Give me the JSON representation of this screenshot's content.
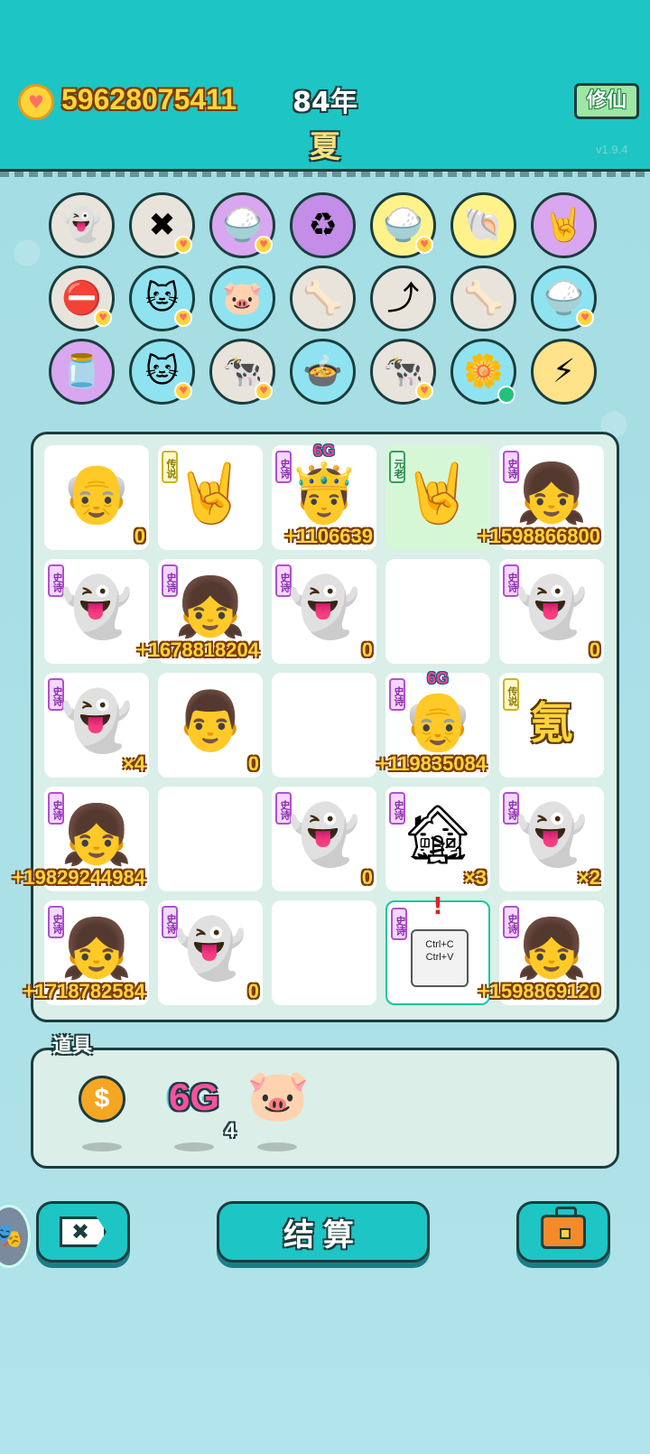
{
  "header": {
    "coins": "59628075411",
    "year": "84年",
    "season": "夏",
    "cultivate_button": "修仙",
    "version": "v1.9.4"
  },
  "items": [
    {
      "icon": "ghost-icon",
      "glyph": "👻",
      "bg": "#e8e4dc",
      "heart": false
    },
    {
      "icon": "close-tag-icon",
      "glyph": "✖",
      "bg": "#e8e4dc",
      "heart": true
    },
    {
      "icon": "rice-bowl-icon",
      "glyph": "🍚",
      "bg": "#d9a6f0",
      "heart": true
    },
    {
      "icon": "recycle-icon",
      "glyph": "♻",
      "bg": "#c48de8",
      "heart": false
    },
    {
      "icon": "rice-bowl-icon",
      "glyph": "🍚",
      "bg": "#fff28a",
      "heart": true
    },
    {
      "icon": "shell-icon",
      "glyph": "🐚",
      "bg": "#fff28a",
      "heart": false
    },
    {
      "icon": "rock-hand-icon",
      "glyph": "🤘",
      "bg": "#d9a6f0",
      "heart": false
    },
    {
      "icon": "no-entry-icon",
      "glyph": "⛔",
      "bg": "#e8e4dc",
      "heart": true
    },
    {
      "icon": "cat-icon",
      "glyph": "🐱",
      "bg": "#8fe3f0",
      "heart": true
    },
    {
      "icon": "piggy-bank-icon",
      "glyph": "🐷",
      "bg": "#8fe3f0",
      "heart": false
    },
    {
      "icon": "pet-bowl-icon",
      "glyph": "🦴",
      "bg": "#e8e4dc",
      "heart": false
    },
    {
      "icon": "arrow-card-icon",
      "glyph": "⤴",
      "bg": "#e8e4dc",
      "heart": false
    },
    {
      "icon": "pet-bowl-icon",
      "glyph": "🦴",
      "bg": "#e8e4dc",
      "heart": false
    },
    {
      "icon": "rice-bowl-icon",
      "glyph": "🍚",
      "bg": "#8fe3f0",
      "heart": true
    },
    {
      "icon": "jar-icon",
      "glyph": "🫙",
      "bg": "#d9a6f0",
      "heart": false
    },
    {
      "icon": "cat-icon",
      "glyph": "🐱",
      "bg": "#8fe3f0",
      "heart": true
    },
    {
      "icon": "cow-icon",
      "glyph": "🐄",
      "bg": "#e8e4dc",
      "heart": true
    },
    {
      "icon": "pot-duck-icon",
      "glyph": "🍲",
      "bg": "#8fe3f0",
      "heart": false
    },
    {
      "icon": "cow-icon",
      "glyph": "🐄",
      "bg": "#e8e4dc",
      "heart": true
    },
    {
      "icon": "flower-pot-icon",
      "glyph": "🌼",
      "bg": "#8fe3f0",
      "heart": false,
      "dot": true
    },
    {
      "icon": "lightning-icon",
      "glyph": "⚡",
      "bg": "#ffe28a",
      "heart": false
    }
  ],
  "board": [
    {
      "name": "old-man-glasses",
      "glyph": "👴",
      "tag": "",
      "value": "0"
    },
    {
      "name": "rock-hand",
      "glyph": "🤘",
      "tag": "传说",
      "tagtype": "legend",
      "value": ""
    },
    {
      "name": "king-glasses",
      "glyph": "🤴",
      "tag": "史诗",
      "tagtype": "epic",
      "value": "+1106639",
      "top": "6G"
    },
    {
      "name": "rock-hand",
      "glyph": "🤘",
      "tag": "元老",
      "tagtype": "meta",
      "value": "",
      "green": true
    },
    {
      "name": "girl-braids",
      "glyph": "👧",
      "tag": "史诗",
      "tagtype": "epic",
      "value": "+1598866800"
    },
    {
      "name": "ghost-love",
      "glyph": "👻",
      "tag": "史诗",
      "tagtype": "epic",
      "value": ""
    },
    {
      "name": "girl-braids",
      "glyph": "👧",
      "tag": "史诗",
      "tagtype": "epic",
      "value": "+1678818204"
    },
    {
      "name": "ghost-dead",
      "glyph": "👻",
      "tag": "史诗",
      "tagtype": "epic",
      "value": "0"
    },
    {
      "name": "empty",
      "glyph": "",
      "tag": "",
      "value": ""
    },
    {
      "name": "ghost-dead",
      "glyph": "👻",
      "tag": "史诗",
      "tagtype": "epic",
      "value": "0"
    },
    {
      "name": "ghost-love",
      "glyph": "👻",
      "tag": "史诗",
      "tagtype": "epic",
      "value": "×4"
    },
    {
      "name": "man-face",
      "glyph": "👨",
      "tag": "",
      "value": "0"
    },
    {
      "name": "empty",
      "glyph": "",
      "tag": "",
      "value": ""
    },
    {
      "name": "old-man-sad",
      "glyph": "👴",
      "tag": "史诗",
      "tagtype": "epic",
      "value": "+119835084",
      "top": "6G"
    },
    {
      "name": "krypton-text",
      "glyph": "",
      "text": "氪",
      "tag": "传说",
      "tagtype": "legend",
      "value": ""
    },
    {
      "name": "girl-braids",
      "glyph": "👧",
      "tag": "史诗",
      "tagtype": "epic",
      "value": "+19829244984"
    },
    {
      "name": "empty",
      "glyph": "",
      "tag": "",
      "value": ""
    },
    {
      "name": "ghost-dead",
      "glyph": "👻",
      "tag": "史诗",
      "tagtype": "epic",
      "value": "0"
    },
    {
      "name": "haunted-house",
      "glyph": "🏚",
      "tag": "史诗",
      "tagtype": "epic",
      "value": "×3"
    },
    {
      "name": "ghost-dead",
      "glyph": "👻",
      "tag": "史诗",
      "tagtype": "epic",
      "value": "×2"
    },
    {
      "name": "girl-braids",
      "glyph": "👧",
      "tag": "史诗",
      "tagtype": "epic",
      "value": "+1718782584"
    },
    {
      "name": "ghost-dead",
      "glyph": "👻",
      "tag": "史诗",
      "tagtype": "epic",
      "value": "0"
    },
    {
      "name": "empty",
      "glyph": "",
      "tag": "",
      "value": ""
    },
    {
      "name": "copy-paste-card",
      "glyph": "",
      "copy": [
        "Ctrl+C",
        "Ctrl+V"
      ],
      "tag": "史诗",
      "tagtype": "epic",
      "value": "",
      "selected": true,
      "alert": "!"
    },
    {
      "name": "girl-braids",
      "glyph": "👧",
      "tag": "史诗",
      "tagtype": "epic",
      "value": "+1598869120"
    }
  ],
  "tools": {
    "label": "道具",
    "coin_symbol": "$",
    "sixg_text": "6G",
    "sixg_count": "4",
    "pig_glyph": "🐷"
  },
  "buttons": {
    "close_glyph": "✖",
    "settle_label": "结算"
  }
}
